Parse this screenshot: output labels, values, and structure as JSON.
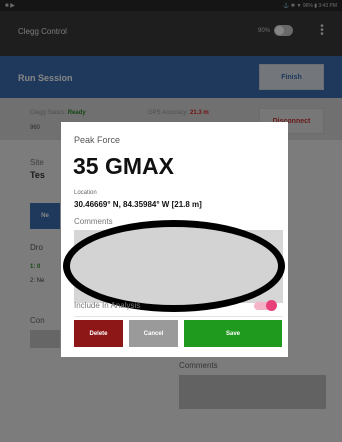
{
  "status_bar": {
    "left_icons": "■ ▶",
    "right_text": "⚓ ✱ ▼ 96% ▮ 3:43 PM"
  },
  "app_bar": {
    "title": "Clegg Control",
    "battery_label": "90%"
  },
  "session_bar": {
    "title": "Run Session",
    "finish_label": "Finish"
  },
  "info": {
    "clegg_status_label": "Clegg Status:",
    "clegg_status_value": "Ready",
    "serial": "960",
    "gps_label": "GPS Accuracy:",
    "gps_value": "21.3 m",
    "disconnect_label": "Disconnect"
  },
  "background": {
    "site_label": "Site",
    "site_value": "Tes",
    "new_button": "Ne",
    "drops_label": "Dro",
    "drop_1": "1: 0",
    "drop_2": "2: Ne",
    "com_label": "Con",
    "comments_label": "Comments"
  },
  "dialog": {
    "peak_label": "Peak Force",
    "peak_value": "35 GMAX",
    "location_label": "Location",
    "location_value": "30.46669° N, 84.35984° W [21.8 m]",
    "comments_label": "Comments",
    "include_label": "Include In Analysis",
    "include_on": true,
    "delete_label": "Delete",
    "cancel_label": "Cancel",
    "save_label": "Save"
  },
  "colors": {
    "accent": "#3b6db0",
    "delete": "#8d1717",
    "save": "#1f9a1f",
    "toggle": "#e8407a"
  }
}
